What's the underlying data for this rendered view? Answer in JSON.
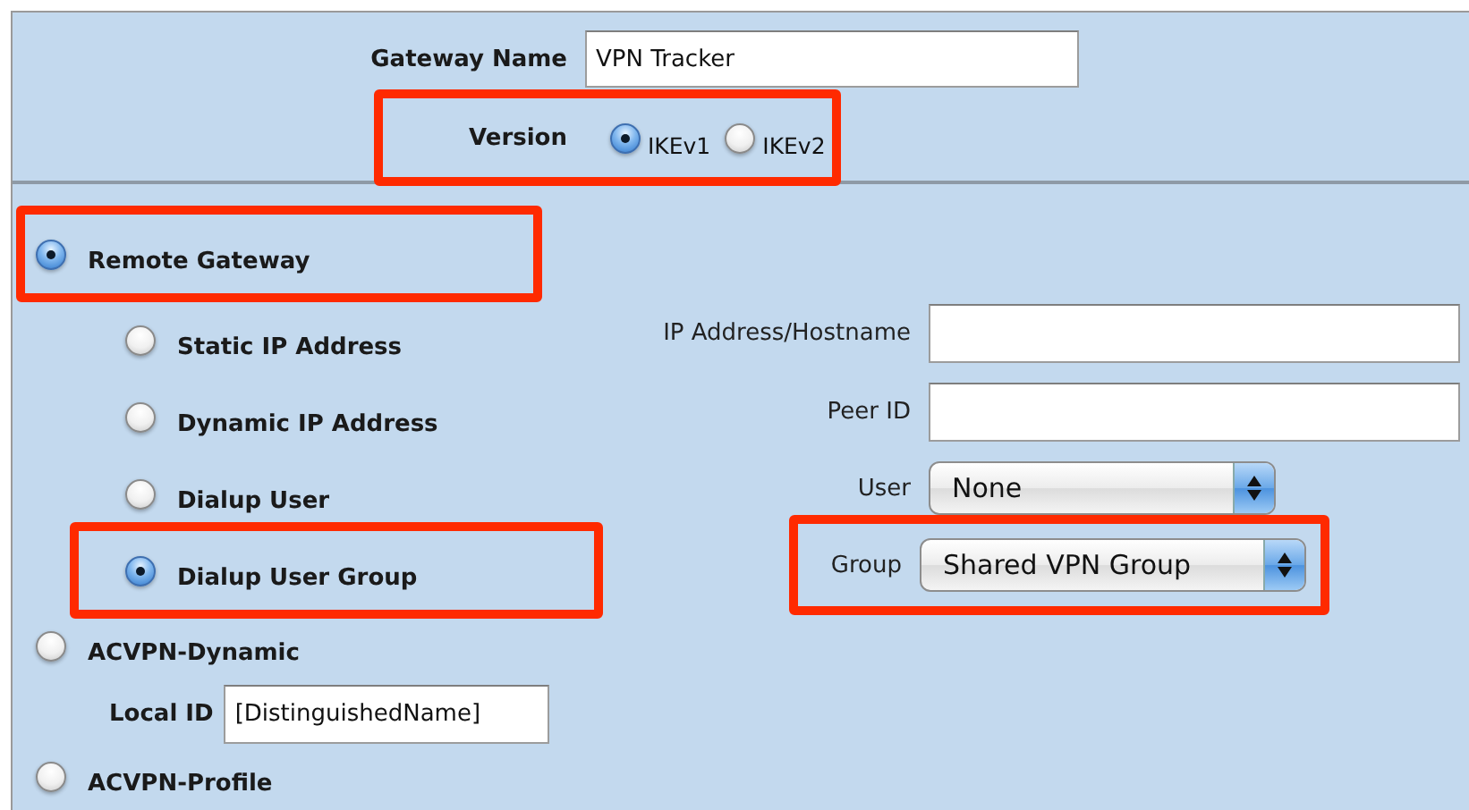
{
  "gateway_name": {
    "label": "Gateway Name",
    "value": "VPN Tracker"
  },
  "version": {
    "label": "Version",
    "highlighted": true,
    "options": [
      {
        "label": "IKEv1",
        "selected": true
      },
      {
        "label": "IKEv2",
        "selected": false
      }
    ]
  },
  "remote_types": [
    {
      "label": "Remote Gateway",
      "selected": true,
      "highlighted": true,
      "options": [
        {
          "label": "Static IP Address",
          "selected": false,
          "highlighted": false
        },
        {
          "label": "Dynamic IP Address",
          "selected": false,
          "highlighted": false
        },
        {
          "label": "Dialup User",
          "selected": false,
          "highlighted": false
        },
        {
          "label": "Dialup User Group",
          "selected": true,
          "highlighted": true
        }
      ]
    },
    {
      "label": "ACVPN-Dynamic",
      "selected": false,
      "highlighted": false,
      "local_id": {
        "label": "Local ID",
        "value": "[DistinguishedName]"
      }
    },
    {
      "label": "ACVPN-Profile",
      "selected": false,
      "highlighted": false
    }
  ],
  "fields": [
    {
      "kind": "text",
      "label": "IP Address/Hostname",
      "highlighted": false
    },
    {
      "kind": "text",
      "label": "Peer ID",
      "highlighted": false
    },
    {
      "kind": "select",
      "label": "User",
      "value": "None",
      "highlighted": false
    },
    {
      "kind": "select",
      "label": "Group",
      "value": "Shared VPN Group",
      "highlighted": true
    }
  ]
}
